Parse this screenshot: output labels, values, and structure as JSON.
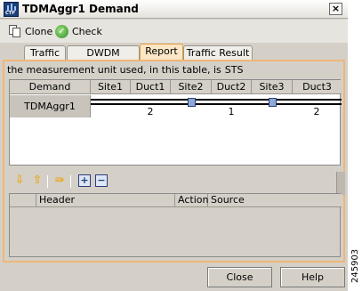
{
  "window": {
    "title": "TDMAggr1 Demand",
    "close_glyph": "×"
  },
  "toolbar": {
    "clone_label": "Clone",
    "check_label": "Check"
  },
  "tabs": [
    {
      "label": "Traffic"
    },
    {
      "label": "DWDM channel"
    },
    {
      "label": "Report",
      "active": true
    },
    {
      "label": "Traffic Result"
    }
  ],
  "report": {
    "unit_prefix": "the measurement unit used, in this table, is",
    "unit": "STS",
    "columns": [
      "Demand",
      "Site1",
      "Duct1",
      "Site2",
      "Duct2",
      "Site3",
      "Duct3"
    ],
    "row": {
      "demand": "TDMAggr1",
      "duct_values": [
        "2",
        "1",
        "2"
      ]
    }
  },
  "actions_table": {
    "columns": [
      "Header",
      "Action",
      "Source"
    ]
  },
  "footer": {
    "close_label": "Close",
    "help_label": "Help"
  },
  "figure_id": "245903",
  "colors": {
    "active_tab": "#fbe6c6",
    "panel_border": "#f0b678",
    "site_box": "#8fa8d8"
  }
}
